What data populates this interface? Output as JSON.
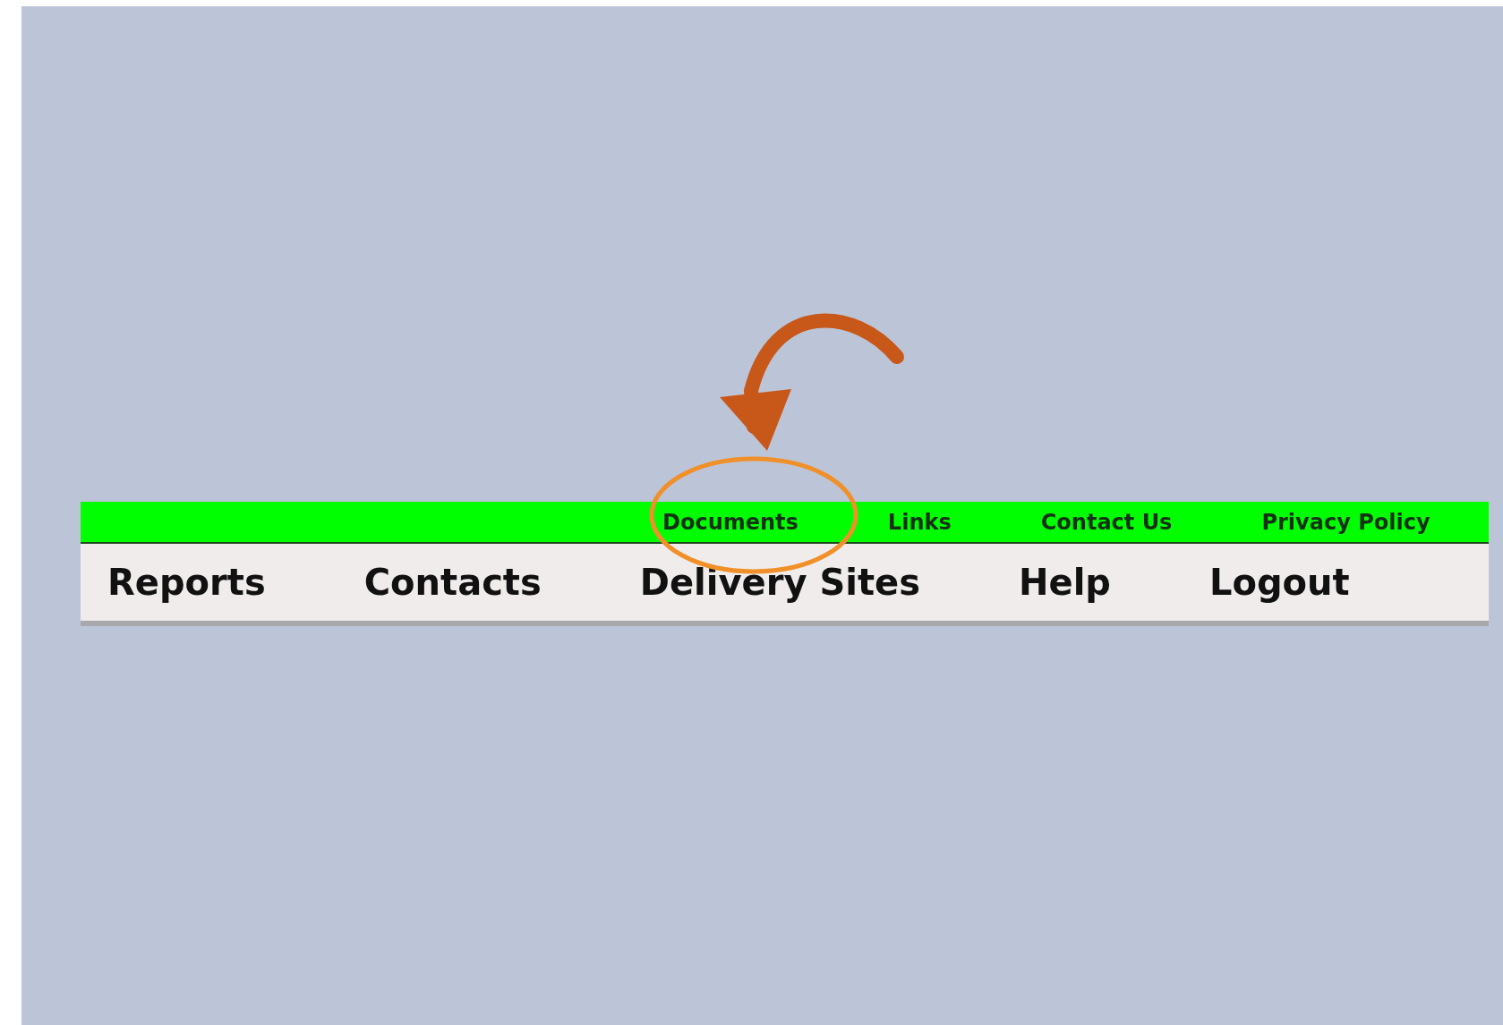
{
  "top_links": [
    {
      "label": "Documents"
    },
    {
      "label": "Links"
    },
    {
      "label": "Contact Us"
    },
    {
      "label": "Privacy Policy"
    }
  ],
  "main_nav": [
    {
      "label": "Reports"
    },
    {
      "label": "Contacts"
    },
    {
      "label": "Delivery Sites"
    },
    {
      "label": "Help"
    },
    {
      "label": "Logout"
    }
  ]
}
